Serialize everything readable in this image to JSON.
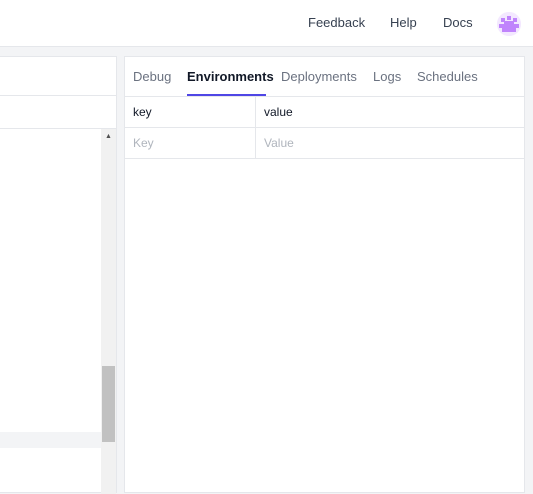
{
  "topnav": {
    "feedback": "Feedback",
    "help": "Help",
    "docs": "Docs"
  },
  "colors": {
    "accent": "#4f46e5",
    "avatar": "#c084fc"
  },
  "tabs": [
    {
      "label": "Debug",
      "active": false
    },
    {
      "label": "Environments",
      "active": true
    },
    {
      "label": "Deployments",
      "active": false
    },
    {
      "label": "Logs",
      "active": false
    },
    {
      "label": "Schedules",
      "active": false
    }
  ],
  "env_table": {
    "header": {
      "key": "key",
      "value": "value"
    },
    "new_row": {
      "key_placeholder": "Key",
      "value_placeholder": "Value"
    }
  }
}
